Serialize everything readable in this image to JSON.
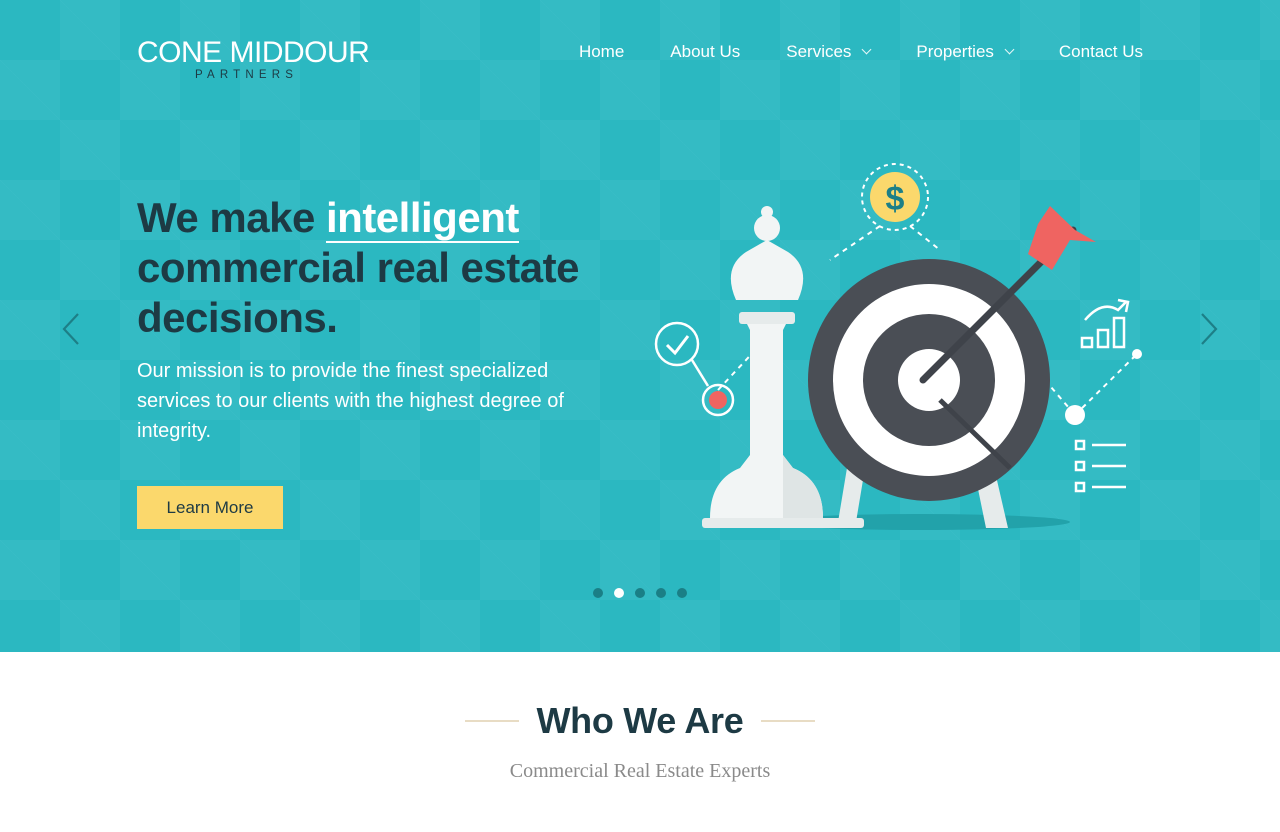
{
  "brand": {
    "name": "CONE MIDDOUR",
    "sub": "PARTNERS"
  },
  "nav": {
    "items": [
      {
        "label": "Home",
        "has_dropdown": false
      },
      {
        "label": "About Us",
        "has_dropdown": false
      },
      {
        "label": "Services",
        "has_dropdown": true
      },
      {
        "label": "Properties",
        "has_dropdown": true
      },
      {
        "label": "Contact Us",
        "has_dropdown": false
      }
    ]
  },
  "hero": {
    "headline_pre": "We make ",
    "headline_highlight": "intelligent",
    "headline_post": "commercial real estate decisions.",
    "mission": "Our mission is to provide the finest specialized services to our clients with the highest degree of integrity.",
    "cta_label": "Learn More",
    "slides_total": 5,
    "active_slide": 2,
    "illustration_icons": [
      "dollar-icon",
      "check-icon",
      "chart-icon",
      "checklist-icon",
      "chess-queen-icon",
      "target-icon",
      "arrow-icon"
    ]
  },
  "who": {
    "title": "Who We Are",
    "subtitle": "Commercial Real Estate Experts"
  },
  "colors": {
    "hero_bg": "#2bb8c1",
    "dark_text": "#1d3a44",
    "cta_bg": "#fbd86c",
    "accent_red": "#ef6461",
    "divider": "#e8dcc4"
  }
}
